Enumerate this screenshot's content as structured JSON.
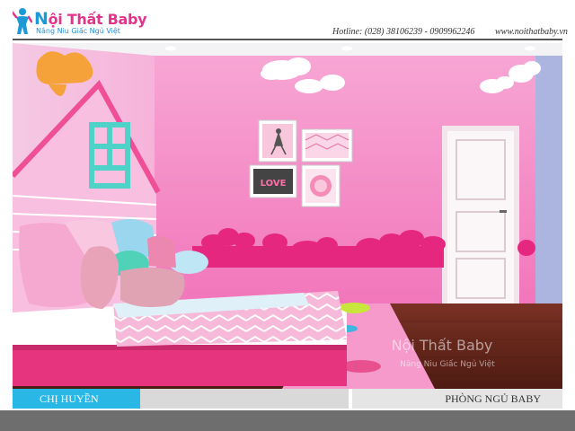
{
  "header": {
    "logo_title_first": "N",
    "logo_title_rest": "ội Thất Baby",
    "logo_tagline": "Nâng Niu Giấc Ngủ Việt",
    "hotline": "Hotline: (028) 38106239  - 0909962246",
    "website": "www.noithatbaby.vn"
  },
  "photo": {
    "pillow_text": "LOVE",
    "watermark_title": "Nội Thất Baby",
    "watermark_tagline": "Nâng Niu Giấc Ngủ Việt"
  },
  "footer": {
    "client_name": "CHỊ HUYỀN",
    "room_name": "PHÒNG NGỦ BABY"
  },
  "colors": {
    "wall_pink": "#f070b8",
    "accent_blue": "#29b7e6",
    "logo_pink": "#e4338a",
    "logo_blue": "#1d9ad6"
  }
}
